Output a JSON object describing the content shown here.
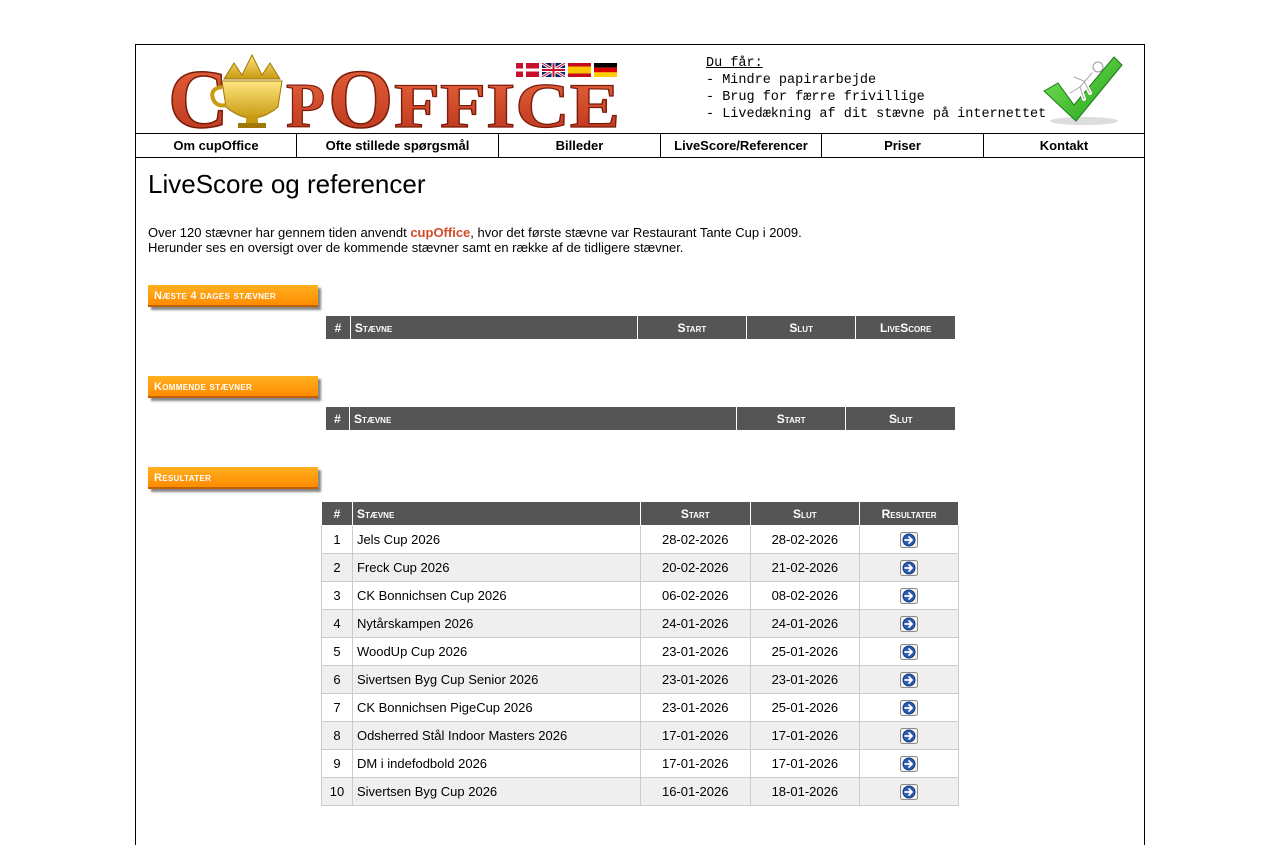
{
  "header": {
    "logo_text": "CupOffice",
    "tagline": {
      "heading": "Du får:",
      "lines": [
        "- Mindre papirarbejde",
        "- Brug for færre frivillige",
        "- Livedækning af dit stævne på internettet"
      ]
    },
    "languages": [
      "Dansk",
      "English",
      "Español",
      "Deutsch"
    ]
  },
  "nav": [
    {
      "label": "Om cupOffice"
    },
    {
      "label": "Ofte stillede spørgsmål"
    },
    {
      "label": "Billeder"
    },
    {
      "label": "LiveScore/Referencer"
    },
    {
      "label": "Priser"
    },
    {
      "label": "Kontakt"
    }
  ],
  "page": {
    "title": "LiveScore og referencer",
    "intro_part1": "Over 120 stævner har gennem tiden anvendt ",
    "intro_brand": "cupOffice",
    "intro_part2": ", hvor det første stævne var Restaurant Tante Cup i 2009.",
    "intro_line2": "Herunder ses en oversigt over de kommende stævner samt en række af de tidligere stævner."
  },
  "sections": {
    "next4": {
      "heading": "Næste 4 dages stævner",
      "columns": [
        "#",
        "Stævne",
        "Start",
        "Slut",
        "LiveScore"
      ]
    },
    "upcoming": {
      "heading": "Kommende stævner",
      "columns": [
        "#",
        "Stævne",
        "Start",
        "Slut"
      ]
    },
    "results": {
      "heading": "Resultater",
      "columns": [
        "#",
        "Stævne",
        "Start",
        "Slut",
        "Resultater"
      ],
      "rows": [
        {
          "n": "1",
          "name": "Jels Cup 2026",
          "start": "28-02-2026",
          "end": "28-02-2026"
        },
        {
          "n": "2",
          "name": "Freck Cup 2026",
          "start": "20-02-2026",
          "end": "21-02-2026"
        },
        {
          "n": "3",
          "name": "CK Bonnichsen Cup 2026",
          "start": "06-02-2026",
          "end": "08-02-2026"
        },
        {
          "n": "4",
          "name": "Nytårskampen 2026",
          "start": "24-01-2026",
          "end": "24-01-2026"
        },
        {
          "n": "5",
          "name": "WoodUp Cup 2026",
          "start": "23-01-2026",
          "end": "25-01-2026"
        },
        {
          "n": "6",
          "name": "Sivertsen Byg Cup Senior 2026",
          "start": "23-01-2026",
          "end": "23-01-2026"
        },
        {
          "n": "7",
          "name": "CK Bonnichsen PigeCup 2026",
          "start": "23-01-2026",
          "end": "25-01-2026"
        },
        {
          "n": "8",
          "name": "Odsherred Stål Indoor Masters 2026",
          "start": "17-01-2026",
          "end": "17-01-2026"
        },
        {
          "n": "9",
          "name": "DM i indefodbold 2026",
          "start": "17-01-2026",
          "end": "17-01-2026"
        },
        {
          "n": "10",
          "name": "Sivertsen Byg Cup 2026",
          "start": "16-01-2026",
          "end": "18-01-2026"
        }
      ]
    }
  },
  "icons": {
    "result_link": "arrow-right-circle-icon",
    "checkmark": "checkmark-icon",
    "crown_cup": "crown-cup-icon"
  },
  "colors": {
    "brand": "#d44a2a",
    "section_tab": "#ff9a10",
    "table_header": "#555555",
    "alt_row": "#efefef"
  }
}
